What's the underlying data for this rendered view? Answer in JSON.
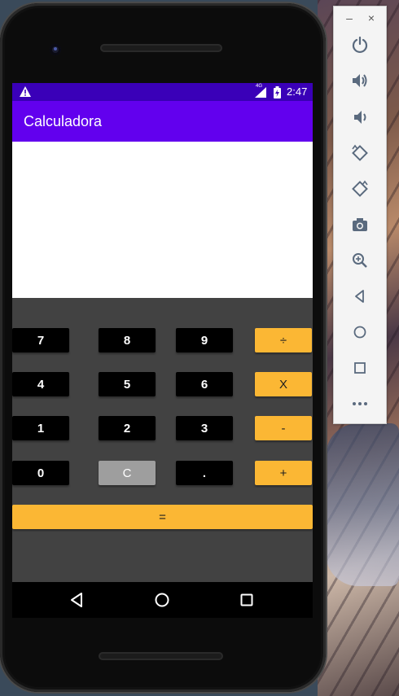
{
  "app": {
    "title": "Calculadora"
  },
  "status_bar": {
    "network": "4G",
    "time": "2:47"
  },
  "display": {
    "value": ""
  },
  "keypad": {
    "rows": [
      [
        "7",
        "8",
        "9",
        "÷"
      ],
      [
        "4",
        "5",
        "6",
        "X"
      ],
      [
        "1",
        "2",
        "3",
        "-"
      ],
      [
        "0",
        "C",
        ".",
        "+"
      ]
    ],
    "equals": "="
  },
  "emulator_panel": {
    "minimize": "–",
    "close": "×",
    "tools": [
      "power-icon",
      "volume-up-icon",
      "volume-down-icon",
      "rotate-left-icon",
      "rotate-right-icon",
      "camera-icon",
      "zoom-icon",
      "back-icon",
      "home-icon",
      "overview-icon",
      "more-icon"
    ]
  },
  "colors": {
    "status_bar": "#3a00b8",
    "app_bar": "#6200ee",
    "keypad_bg": "#424242",
    "number_key": "#000000",
    "operator_key": "#fbb734",
    "clear_key": "#9e9e9e"
  }
}
